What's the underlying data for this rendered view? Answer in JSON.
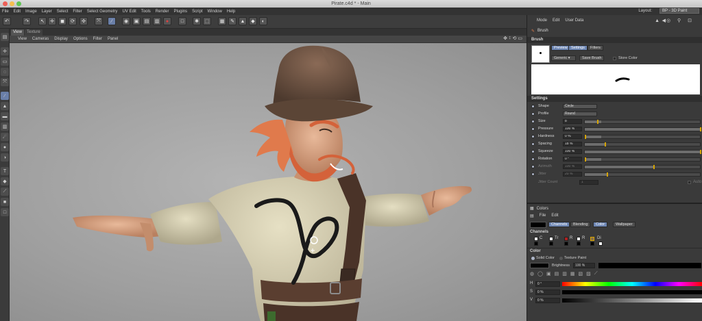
{
  "window": {
    "title": "Pirate.c4d * - Main"
  },
  "menubar": {
    "items": [
      "File",
      "Edit",
      "Image",
      "Layer",
      "Select",
      "Filter",
      "Select Geometry",
      "UV Edit",
      "Tools",
      "Render",
      "Plugins",
      "Script",
      "Window",
      "Help"
    ],
    "layout_label": "Layout:",
    "layout_value": "BP - 3D Paint"
  },
  "viewport_tabs": [
    "View",
    "Texture"
  ],
  "viewport_menu": [
    "View",
    "Cameras",
    "Display",
    "Options",
    "Filter",
    "Panel"
  ],
  "attributes": {
    "menu": [
      "Mode",
      "Edit",
      "User Data"
    ],
    "object_name": "Brush",
    "section": "Brush",
    "tabs": [
      "Preview",
      "Settings",
      "Filters"
    ],
    "preset_value": "Generic",
    "save_brush": "Save Brush",
    "store_color": "Store Color",
    "settings_section": "Settings",
    "params": [
      {
        "label": "Shape",
        "value": "Circle",
        "kind": "select"
      },
      {
        "label": "Profile",
        "value": "Round",
        "kind": "select"
      },
      {
        "label": "Size",
        "value": "8",
        "kind": "slider",
        "level": 0.12
      },
      {
        "label": "Pressure",
        "value": "100 %",
        "kind": "slider",
        "level": 1.0
      },
      {
        "label": "Hardness",
        "value": "0 %",
        "kind": "slider",
        "level": 0.0
      },
      {
        "label": "Spacing",
        "value": "18 %",
        "kind": "slider",
        "level": 0.18
      },
      {
        "label": "Squeeze",
        "value": "100 %",
        "kind": "slider",
        "level": 1.0
      },
      {
        "label": "Rotation",
        "value": "0 °",
        "kind": "slider",
        "level": 0.0
      },
      {
        "label": "Azimuth",
        "value": "100 %",
        "kind": "slider",
        "level": 0.6,
        "dim": true
      },
      {
        "label": "Jitter",
        "value": "20 %",
        "kind": "slider",
        "level": 0.2,
        "dim": true
      },
      {
        "label": "Jitter Count",
        "value": "1",
        "kind": "plain",
        "dim": true
      }
    ],
    "auto_label": "Auto"
  },
  "colors": {
    "header": "Colors",
    "menu": [
      "File",
      "Edit"
    ],
    "tabs": [
      "Channels",
      "Blending",
      "Color",
      "Wallpaper"
    ],
    "channels_label": "Channels",
    "channel_items": [
      "C",
      "Tr",
      "R",
      "R",
      "Di"
    ],
    "color_label": "Color",
    "solid_color": "Solid Color",
    "texture_paint": "Texture Paint",
    "brightness_label": "Brightness",
    "brightness_value": "100 %",
    "h_label": "H",
    "h_value": "0 °",
    "s_label": "S",
    "s_value": "0 %",
    "v_label": "V",
    "v_value": "0 %"
  }
}
